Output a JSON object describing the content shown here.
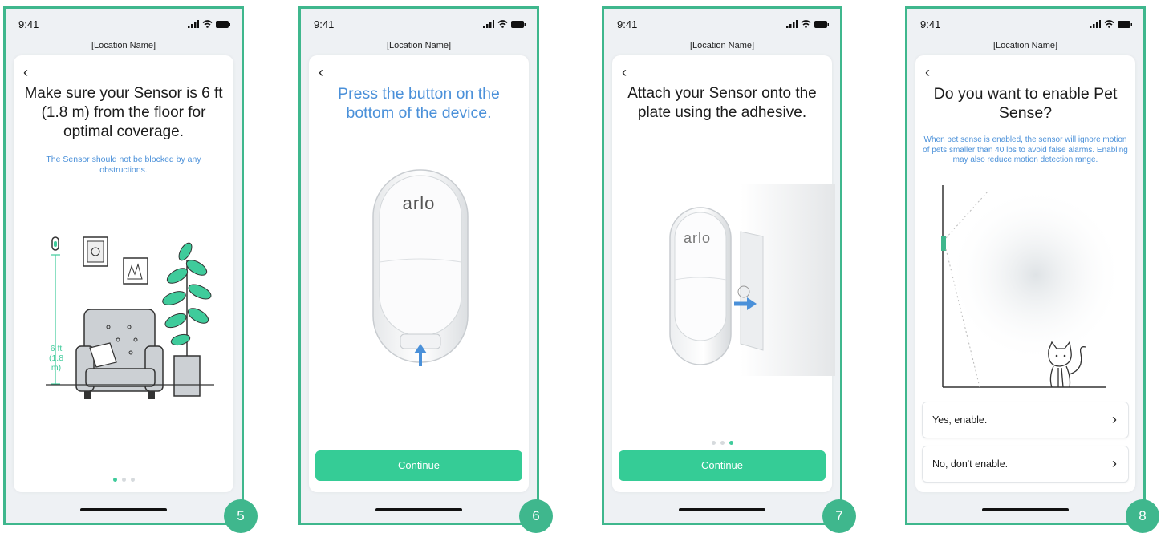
{
  "status": {
    "time": "9:41",
    "location": "[Location Name]"
  },
  "screens": [
    {
      "step": "5",
      "title": "Make sure your Sensor is 6 ft (1.8 m) from the floor for optimal coverage.",
      "subtitle": "The Sensor should not be blocked by any obstructions.",
      "height_label_1": "6 ft",
      "height_label_2": "(1.8",
      "height_label_3": "m)",
      "page_dots": {
        "count": 3,
        "active": 1
      }
    },
    {
      "step": "6",
      "title": "Press the button on the bottom of the device.",
      "device_logo": "arlo",
      "continue_label": "Continue"
    },
    {
      "step": "7",
      "title": "Attach your Sensor onto the plate using the adhesive.",
      "device_logo": "arlo",
      "page_dots": {
        "count": 3,
        "active": 3
      },
      "continue_label": "Continue"
    },
    {
      "step": "8",
      "title": "Do you want to enable Pet Sense?",
      "subtitle": "When pet sense is enabled, the sensor will ignore motion of pets smaller than 40 lbs to avoid false alarms. Enabling may also reduce motion detection range.",
      "options": [
        {
          "label": "Yes, enable."
        },
        {
          "label": "No, don't enable."
        }
      ]
    }
  ],
  "colors": {
    "accent": "#3fb78d",
    "button": "#35cc96",
    "link_blue": "#4a90d9"
  },
  "icons": {
    "back": "chevron-left-icon",
    "option": "chevron-right-icon"
  }
}
